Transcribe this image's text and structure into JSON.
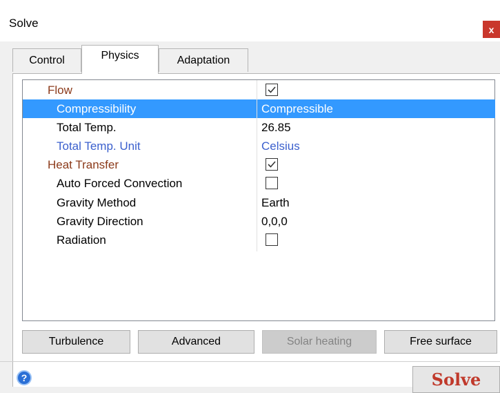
{
  "window": {
    "title": "Solve",
    "close_label": "x"
  },
  "tabs": [
    {
      "label": "Control",
      "active": false
    },
    {
      "label": "Physics",
      "active": true
    },
    {
      "label": "Adaptation",
      "active": false
    }
  ],
  "properties": [
    {
      "name": "Flow",
      "type": "category",
      "value_type": "checkbox",
      "checked": true
    },
    {
      "name": "Compressibility",
      "value": "Compressible",
      "selected": true
    },
    {
      "name": "Total Temp.",
      "value": "26.85"
    },
    {
      "name": "Total Temp. Unit",
      "value": "Celsius",
      "style": "blue"
    },
    {
      "name": "Heat Transfer",
      "type": "category",
      "value_type": "checkbox",
      "checked": true
    },
    {
      "name": "Auto Forced Convection",
      "value_type": "checkbox",
      "checked": false
    },
    {
      "name": "Gravity Method",
      "value": "Earth"
    },
    {
      "name": "Gravity Direction",
      "value": "0,0,0"
    },
    {
      "name": "Radiation",
      "value_type": "checkbox",
      "checked": false
    }
  ],
  "buttons": {
    "turbulence": "Turbulence",
    "advanced": "Advanced",
    "solar_heating": "Solar heating",
    "free_surface": "Free surface"
  },
  "footer": {
    "help_icon": "?",
    "solve_label": "Solve"
  },
  "colors": {
    "selection": "#3399ff",
    "category_text": "#8b3a1a",
    "blue_text": "#3a5fcd",
    "solve_text": "#c0392b",
    "close_bg": "#c9372c"
  }
}
